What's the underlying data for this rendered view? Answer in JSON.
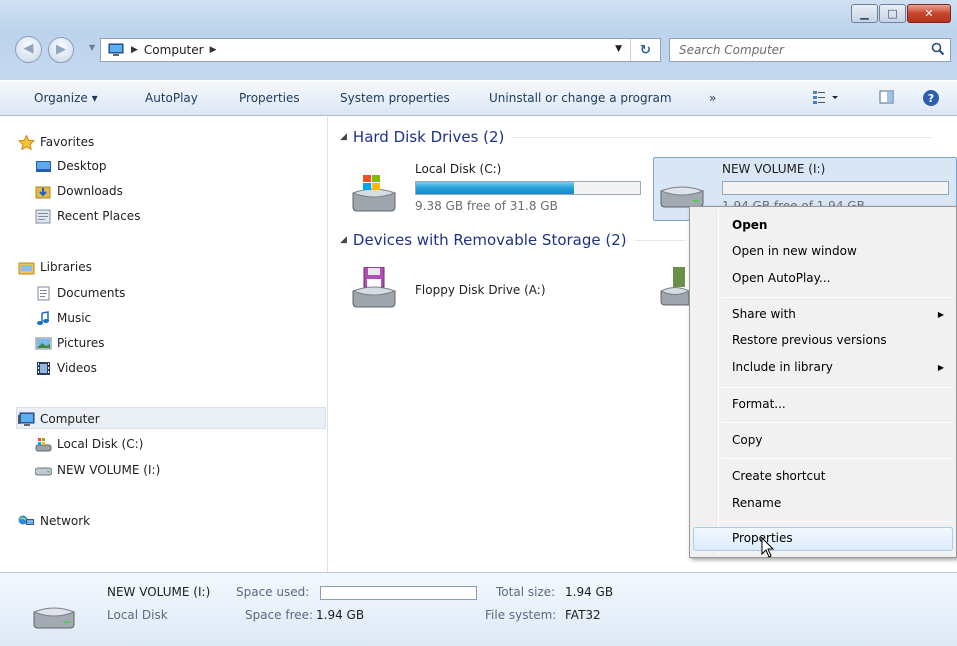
{
  "window": {
    "address": {
      "crumb": "Computer"
    },
    "search": {
      "placeholder": "Search Computer"
    }
  },
  "toolbar": {
    "organize": "Organize ▾",
    "autoplay": "AutoPlay",
    "properties": "Properties",
    "system_properties": "System properties",
    "uninstall": "Uninstall or change a program",
    "more": "»"
  },
  "nav": {
    "favorites": "Favorites",
    "desktop": "Desktop",
    "downloads": "Downloads",
    "recent": "Recent Places",
    "libraries": "Libraries",
    "documents": "Documents",
    "music": "Music",
    "pictures": "Pictures",
    "videos": "Videos",
    "computer": "Computer",
    "local_disk": "Local Disk (C:)",
    "new_volume": "NEW VOLUME (I:)",
    "network": "Network"
  },
  "content": {
    "hdd_group": "Hard Disk Drives (2)",
    "removable_group": "Devices with Removable Storage (2)",
    "drive_c": {
      "name": "Local Disk (C:)",
      "free": "9.38 GB free of 31.8 GB",
      "used_fraction": 0.705
    },
    "drive_i": {
      "name": "NEW VOLUME (I:)",
      "free": "1.94 GB free of 1.94 GB",
      "used_fraction": 0.0
    },
    "floppy": {
      "name": "Floppy Disk Drive (A:)"
    }
  },
  "context_menu": {
    "open": "Open",
    "open_new_window": "Open in new window",
    "open_autoplay": "Open AutoPlay...",
    "share_with": "Share with",
    "restore": "Restore previous versions",
    "include_library": "Include in library",
    "format": "Format...",
    "copy": "Copy",
    "create_shortcut": "Create shortcut",
    "rename": "Rename",
    "properties": "Properties"
  },
  "details": {
    "name": "NEW VOLUME (I:)",
    "type": "Local Disk",
    "space_used_label": "Space used:",
    "space_free_label": "Space free:",
    "space_free_value": "1.94 GB",
    "total_size_label": "Total size:",
    "total_size_value": "1.94 GB",
    "file_system_label": "File system:",
    "file_system_value": "FAT32"
  }
}
